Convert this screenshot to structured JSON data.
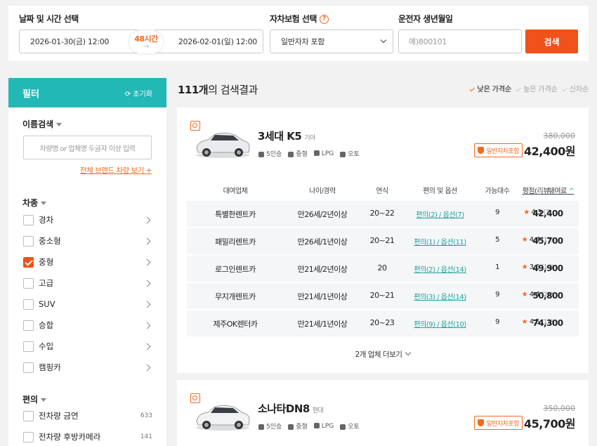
{
  "search": {
    "date_label": "날짜 및 시간 선택",
    "start": "2026-01-30(금) 12:00",
    "end": "2026-02-01(일) 12:00",
    "duration": "48시간",
    "insurance_label": "자차보험 선택",
    "insurance_value": "일반자차 포함",
    "birth_label": "운전자 생년월일",
    "birth_placeholder": "예)800101",
    "search_btn": "검색"
  },
  "sidebar": {
    "title": "필터",
    "reset": "초기화",
    "name_search_label": "이름검색",
    "name_placeholder": "차량명 or 업체명 두글자 이상 입력",
    "brand_link": "전체 브랜드 차량 보기 +",
    "car_type_label": "차종",
    "car_types": [
      {
        "label": "경차",
        "checked": false
      },
      {
        "label": "중소형",
        "checked": false
      },
      {
        "label": "중형",
        "checked": true
      },
      {
        "label": "고급",
        "checked": false
      },
      {
        "label": "SUV",
        "checked": false
      },
      {
        "label": "승합",
        "checked": false
      },
      {
        "label": "수입",
        "checked": false
      },
      {
        "label": "캠핑카",
        "checked": false
      }
    ],
    "convenience_label": "편의",
    "convenience": [
      {
        "label": "전차량 금연",
        "count": "633"
      },
      {
        "label": "전차량 후방카메라",
        "count": "141"
      }
    ]
  },
  "results": {
    "count": "111개",
    "suffix": "의 검색결과",
    "sorts": [
      "낮은 가격순",
      "높은 가격순",
      "신차순"
    ]
  },
  "table_headers": [
    "대여업체",
    "나이/경력",
    "연식",
    "편의 및 옵션",
    "가능대수",
    "평점(리뷰)",
    "대여료"
  ],
  "cars": [
    {
      "name": "3세대 K5",
      "brand": "기아",
      "specs": [
        "5인승",
        "중형",
        "LPG",
        "오토"
      ],
      "orig_price": "380,000",
      "badge": "일반자차포함",
      "price": "42,400원",
      "rows": [
        {
          "company": "특별한렌트카",
          "age": "만26세/2년이상",
          "year": "20~22",
          "opt": "편의(2) / 옵션(7)",
          "qty": "9",
          "rating": "4.3",
          "reviews": "(7)",
          "fee": "42,400"
        },
        {
          "company": "패밀리렌트카",
          "age": "만26세/1년이상",
          "year": "20~21",
          "opt": "편의(1) / 옵션(11)",
          "qty": "5",
          "rating": "4.4",
          "reviews": "(15)",
          "fee": "45,700"
        },
        {
          "company": "로그인렌트카",
          "age": "만21세/2년이상",
          "year": "20",
          "opt": "편의(2) / 옵션(14)",
          "qty": "1",
          "rating": "3.6",
          "reviews": "(14)",
          "fee": "49,900"
        },
        {
          "company": "무지개렌트카",
          "age": "만21세/1년이상",
          "year": "20~21",
          "opt": "편의(3) / 옵션(14)",
          "qty": "9",
          "rating": "4.4",
          "reviews": "(21)",
          "fee": "50,800"
        },
        {
          "company": "제주OK렌터카",
          "age": "만21세/1년이상",
          "year": "20~23",
          "opt": "편의(9) / 옵션(10)",
          "qty": "9",
          "rating": "4.5",
          "reviews": "(13)",
          "fee": "74,300"
        }
      ],
      "more": "2개 업체 더보기"
    },
    {
      "name": "소나타DN8",
      "brand": "현대",
      "specs": [
        "5인승",
        "중형",
        "LPG",
        "오토"
      ],
      "orig_price": "350,000",
      "badge": "일반자차포함",
      "price": "45,700원"
    }
  ],
  "colors": {
    "accent": "#f1511b",
    "teal": "#22b8b6",
    "link_teal": "#22a39f"
  }
}
